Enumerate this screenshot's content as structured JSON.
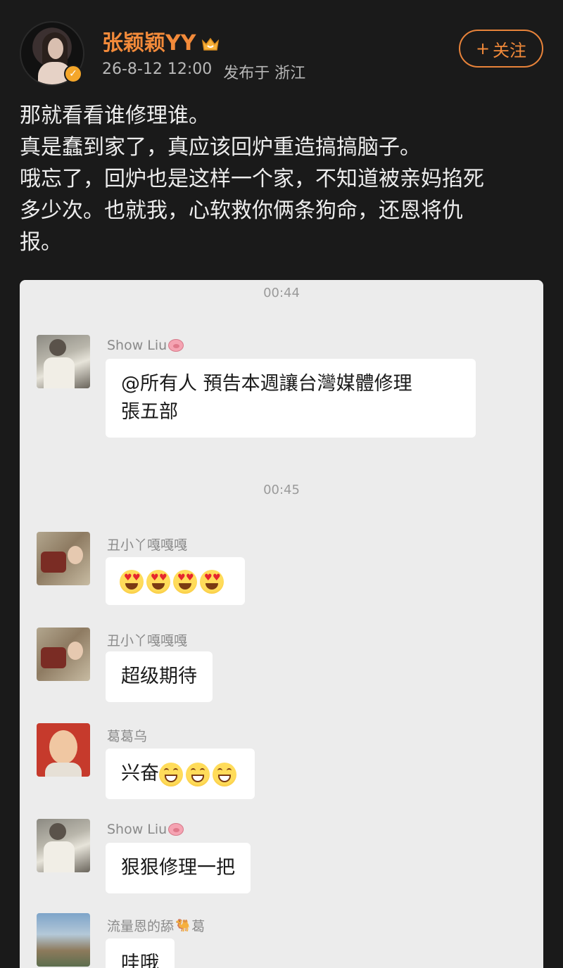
{
  "post": {
    "username": "张颖颖YY",
    "date": "26-8-12 12:00",
    "location": "发布于 浙江",
    "follow_label": "关注",
    "text_lines": [
      "那就看看谁修理谁。",
      "真是蠢到家了，真应该回炉重造搞搞脑子。",
      "哦忘了，回炉也是这样一个家，不知道被亲妈掐死",
      "多少次。也就我，心软救你俩条狗命，还恩将仇",
      "报。"
    ]
  },
  "chat": {
    "time1": "00:44",
    "time2": "00:45",
    "messages": [
      {
        "name": "Show Liu",
        "text_line1": "@所有人  預告本週讓台灣媒體修理",
        "text_line2": "張五部"
      },
      {
        "name": "丑小丫嘎嘎嘎",
        "emoji": [
          "heart-eyes",
          "heart-eyes",
          "heart-eyes",
          "heart-eyes"
        ]
      },
      {
        "name": "丑小丫嘎嘎嘎",
        "text": "超级期待"
      },
      {
        "name": "葛葛乌",
        "text": "兴奋"
      },
      {
        "name": "Show Liu",
        "text": "狠狠修理一把"
      },
      {
        "name": "流量恩的舔",
        "name_suffix": "葛",
        "text": "哇哦"
      }
    ]
  },
  "colors": {
    "background": "#1a1a1a",
    "accent": "#f28a3a",
    "chat_bg": "#ececec",
    "bubble": "#ffffff"
  },
  "icons": [
    "crown-icon",
    "verified-icon",
    "plus-icon",
    "pig-icon",
    "camel-icon"
  ]
}
